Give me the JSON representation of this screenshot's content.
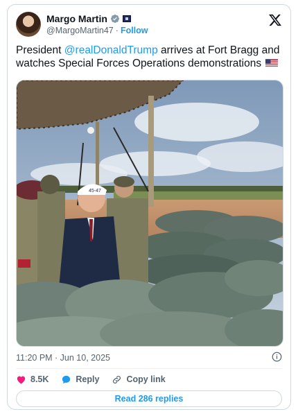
{
  "author": {
    "display_name": "Margo Martin",
    "handle": "@MargoMartin47",
    "separator": "·",
    "follow_label": "Follow"
  },
  "tweet": {
    "text_prefix": "President ",
    "mention": "@realDonaldTrump",
    "text_suffix": " arrives at Fort Bragg and watches Special Forces Operations demonstrations",
    "flag_emoji_icon": "us-flag-icon"
  },
  "media": {
    "cap_text": "45-47"
  },
  "meta": {
    "timestamp": "11:20 PM · Jun 10, 2025"
  },
  "actions": {
    "likes": "8.5K",
    "reply_label": "Reply",
    "copy_link_label": "Copy link"
  },
  "footer": {
    "read_replies_label": "Read 286 replies"
  },
  "colors": {
    "accent": "#1d9bf0",
    "heart": "#f91880",
    "text": "#0f1419",
    "muted": "#536471"
  }
}
